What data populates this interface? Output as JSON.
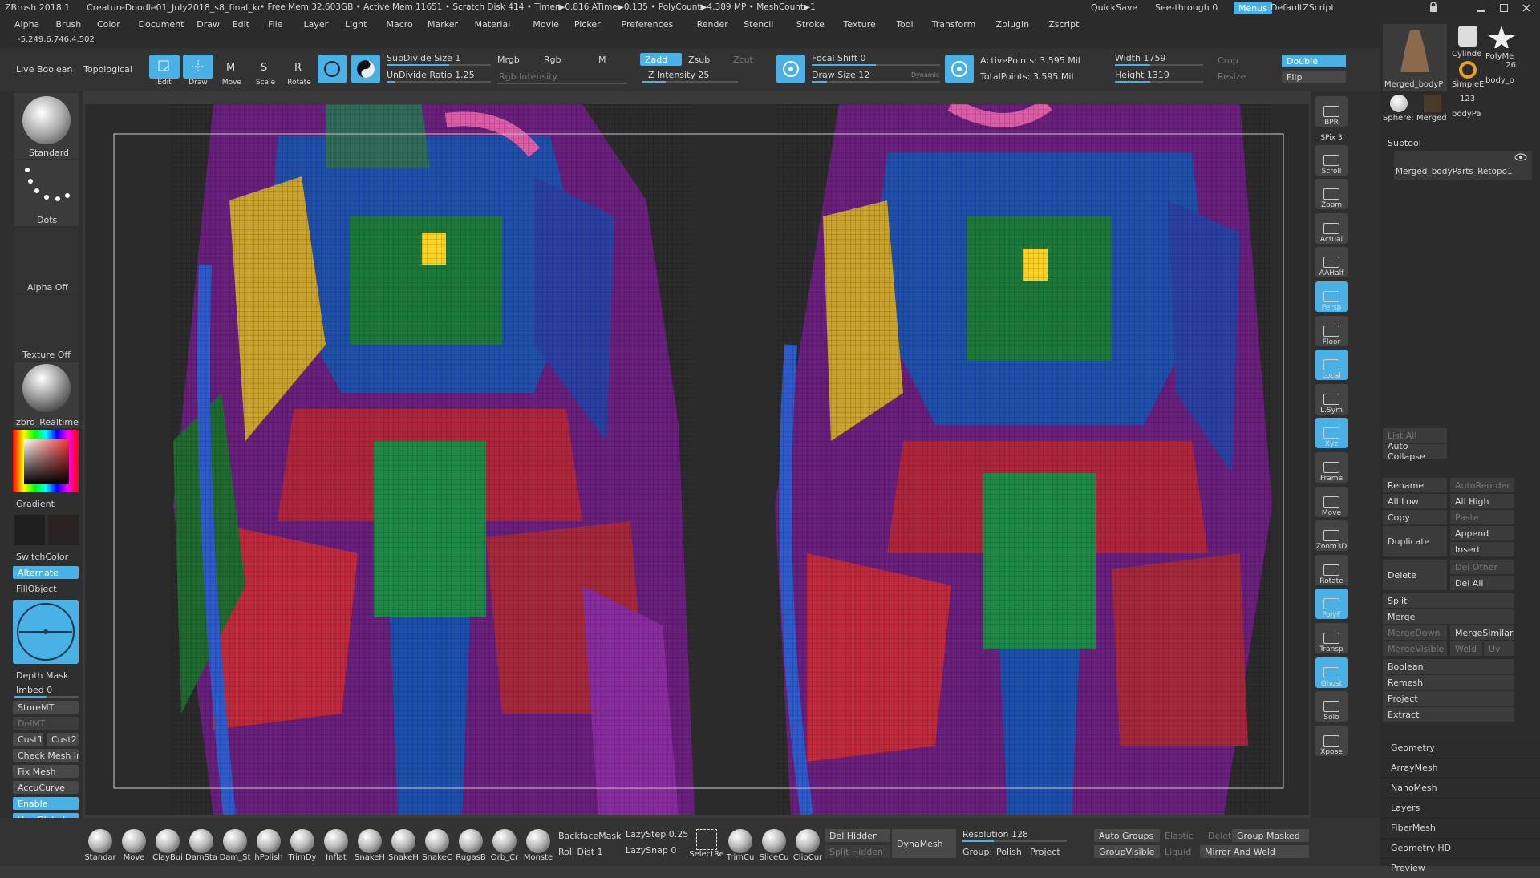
{
  "titlebar": {
    "app": "ZBrush 2018.1",
    "doc": "CreatureDoodle01_July2018_s8_final_kc",
    "stats": "• Free Mem 32.603GB • Active Mem 11651 • Scratch Disk 414 • Timer▶0.816 ATime▶0.135 • PolyCount▶4.389 MP • MeshCount▶1",
    "quicksave": "QuickSave",
    "seethrough": "See-through  0",
    "menus": "Menus",
    "defaultzscript": "DefaultZScript"
  },
  "menus": [
    "Alpha",
    "Brush",
    "Color",
    "Document",
    "Draw",
    "Edit",
    "File",
    "Layer",
    "Light",
    "Macro",
    "Marker",
    "Material",
    "Movie",
    "Picker",
    "Preferences",
    "Render",
    "Stencil",
    "Stroke",
    "Texture",
    "Tool",
    "Transform",
    "Zplugin",
    "Zscript"
  ],
  "coords": "-5.249,6.746,4.502",
  "toptools": {
    "live_boolean": "Live Boolean",
    "topological": "Topological",
    "edit": "Edit",
    "draw": "Draw",
    "move": "Move",
    "scale": "Scale",
    "rotate": "Rotate",
    "subdivide": "SubDivide Size 1",
    "undivide": "UnDivide Ratio 1.25",
    "mrgb": "Mrgb",
    "rgb": "Rgb",
    "m": "M",
    "rgb_intensity": "Rgb Intensity",
    "zadd": "Zadd",
    "zsub": "Zsub",
    "zcut": "Zcut",
    "z_intensity": "Z Intensity 25",
    "focal_shift": "Focal Shift 0",
    "draw_size": "Draw Size 12",
    "dynamic": "Dynamic",
    "active_points": "ActivePoints: 3.595 Mil",
    "total_points": "TotalPoints: 3.595 Mil",
    "width": "Width 1759",
    "height": "Height 1319",
    "crop": "Crop",
    "resize": "Resize",
    "double": "Double",
    "flip": "Flip"
  },
  "leftshelf": {
    "standard": "Standard",
    "dots": "Dots",
    "alpha_off": "Alpha Off",
    "texture_off": "Texture Off",
    "material": "zbro_Realtime_",
    "gradient": "Gradient",
    "switchcolor": "SwitchColor",
    "alternate": "Alternate",
    "fillobject": "FillObject",
    "depth_mask": "Depth Mask",
    "imbed": "Imbed 0",
    "storemt": "StoreMT",
    "delmt": "DelMT",
    "cust1": "Cust1",
    "cust2": "Cust2",
    "check_mesh": "Check Mesh In",
    "fix_mesh": "Fix Mesh",
    "accucurve": "AccuCurve",
    "enable": "Enable",
    "use_global": "Use Global"
  },
  "rightshelf": [
    "BPR",
    "SPix 3",
    "Scroll",
    "Zoom",
    "Actual",
    "AAHalf",
    "Persp",
    "Floor",
    "Local",
    "L.Sym",
    "Xyz",
    "Frame",
    "Move",
    "Zoom3D",
    "Rotate",
    "PolyF",
    "Transp",
    "Ghost",
    "Solo",
    "Xpose"
  ],
  "rightpanel": {
    "thumb1": "Merged_bodyP",
    "thumb2": "Cylinde",
    "thumb3": "PolyMe",
    "thumb4": "SimpleE",
    "thumb5": "body_o",
    "count": "26",
    "thumb6": "Sphere:",
    "thumb7": "Merged",
    "thumb8": "bodyPa",
    "count2": "123",
    "subtool": "Subtool",
    "subtool_item": "Merged_bodyParts_Retopo1",
    "list_all": "List All",
    "auto_collapse": "Auto Collapse",
    "rename": "Rename",
    "autoreorder": "AutoReorder",
    "all_low": "All Low",
    "all_high": "All High",
    "copy": "Copy",
    "paste": "Paste",
    "duplicate": "Duplicate",
    "append": "Append",
    "insert": "Insert",
    "delete": "Delete",
    "del_other": "Del Other",
    "del_all": "Del All",
    "split": "Split",
    "merge": "Merge",
    "mergedown": "MergeDown",
    "mergesimilar": "MergeSimilar",
    "mergevisible": "MergeVisible",
    "weld": "Weld",
    "uv": "Uv",
    "boolean": "Boolean",
    "remesh": "Remesh",
    "project": "Project",
    "extract": "Extract",
    "sections": [
      "Geometry",
      "ArrayMesh",
      "NanoMesh",
      "Layers",
      "FiberMesh",
      "Geometry HD",
      "Preview"
    ]
  },
  "bottombar": {
    "brushes": [
      "Standar",
      "Move",
      "ClayBui",
      "DamSta",
      "Dam_St",
      "hPolish",
      "TrimDy",
      "Inflat",
      "SnakeH",
      "SnakeH",
      "SnakeC",
      "RugasB",
      "Orb_Cr",
      "Monste"
    ],
    "backfacemask": "BackfaceMask",
    "roll_dist": "Roll Dist 1",
    "lazystep": "LazyStep 0.25",
    "lazysnap": "LazySnap 0",
    "selectre": "SelectRe",
    "trimcu": "TrimCu",
    "slicecu": "SliceCu",
    "clipcur": "ClipCur",
    "del_hidden": "Del Hidden",
    "split_hidden": "Split Hidden",
    "dynamesh": "DynaMesh",
    "resolution": "Resolution 128",
    "group": "Group:",
    "polish": "Polish",
    "project": "Project",
    "auto_groups": "Auto Groups",
    "groupvisible": "GroupVisible",
    "elastic": "Elastic",
    "liquid": "Liquid",
    "delete": "Delete",
    "group_masked": "Group Masked",
    "mirror_weld": "Mirror And Weld"
  },
  "colors": {
    "accent": "#4ab1e6",
    "bg": "#2a2a2a"
  }
}
